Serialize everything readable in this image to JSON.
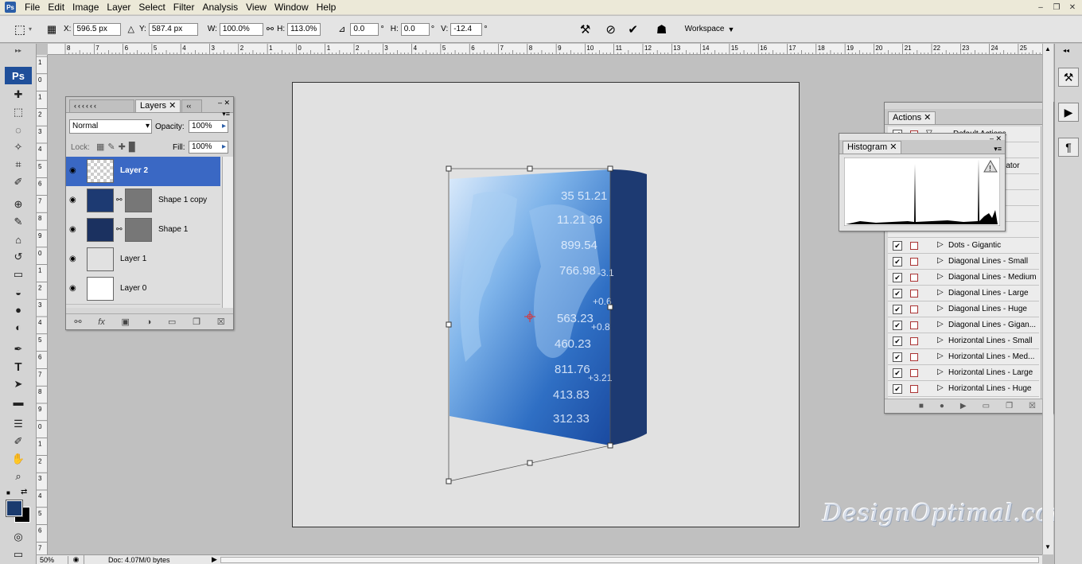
{
  "menu": {
    "items": [
      "File",
      "Edit",
      "Image",
      "Layer",
      "Select",
      "Filter",
      "Analysis",
      "View",
      "Window",
      "Help"
    ]
  },
  "app": {
    "badge": "Ps"
  },
  "options": {
    "x_label": "X:",
    "x_value": "596.5 px",
    "y_label": "Y:",
    "y_value": "587.4 px",
    "w_label": "W:",
    "w_value": "100.0%",
    "h_label": "H:",
    "h_value": "113.0%",
    "rot_value": "0.0",
    "rot_unit": "°",
    "hskew_label": "H:",
    "hskew_value": "0.0",
    "hskew_unit": "°",
    "vskew_label": "V:",
    "vskew_value": "-12.4",
    "vskew_unit": "°",
    "workspace_label": "Workspace"
  },
  "ruler": {
    "top": [
      "8",
      "7",
      "6",
      "5",
      "4",
      "3",
      "2",
      "1",
      "0",
      "1",
      "2",
      "3",
      "4",
      "5",
      "6",
      "7",
      "8",
      "9",
      "10",
      "11",
      "12",
      "13",
      "14",
      "15",
      "16",
      "17",
      "18",
      "19",
      "20",
      "21",
      "22",
      "23",
      "24",
      "25"
    ],
    "left": [
      "1",
      "0",
      "1",
      "2",
      "3",
      "4",
      "5",
      "6",
      "7",
      "8",
      "9",
      "0",
      "1",
      "2",
      "3",
      "4",
      "5",
      "6",
      "7",
      "8",
      "9",
      "0",
      "1",
      "2",
      "3",
      "4",
      "5",
      "6",
      "7",
      "8"
    ]
  },
  "layers_panel": {
    "tab_label": "Layers",
    "blend_mode": "Normal",
    "opacity_label": "Opacity:",
    "opacity_value": "100%",
    "lock_label": "Lock:",
    "fill_label": "Fill:",
    "fill_value": "100%",
    "layers": [
      {
        "name": "Layer 2",
        "selected": true
      },
      {
        "name": "Shape 1 copy",
        "selected": false
      },
      {
        "name": "Shape 1",
        "selected": false
      },
      {
        "name": "Layer 1",
        "selected": false
      },
      {
        "name": "Layer 0",
        "selected": false
      }
    ]
  },
  "actions_panel": {
    "tab_label": "Actions",
    "default_set": "Default Actions",
    "partial_item": "mator",
    "items": [
      "Dots - Gigantic",
      "Diagonal Lines - Small",
      "Diagonal Lines - Medium",
      "Diagonal Lines - Large",
      "Diagonal Lines - Huge",
      "Diagonal Lines - Gigan...",
      "Horizontal Lines - Small",
      "Horizontal Lines - Med...",
      "Horizontal Lines - Large",
      "Horizontal Lines - Huge"
    ]
  },
  "histogram_panel": {
    "tab_label": "Histogram"
  },
  "status": {
    "zoom": "50%",
    "doc_info": "Doc: 4.07M/0 bytes"
  },
  "watermark": {
    "text": "DesignOptimal.com"
  },
  "artwork": {
    "numbers": [
      "35 51.21",
      "11.21 36",
      "899.54",
      "766.98",
      "563.23",
      "460.23",
      "811.76",
      "413.83",
      "312.33",
      "+0.6",
      "+0.8",
      "+3.21",
      "-3.1"
    ]
  },
  "colors": {
    "accent": "#3a68c4",
    "foreground": "#1b3b6e",
    "box_side": "#1d3a72"
  }
}
